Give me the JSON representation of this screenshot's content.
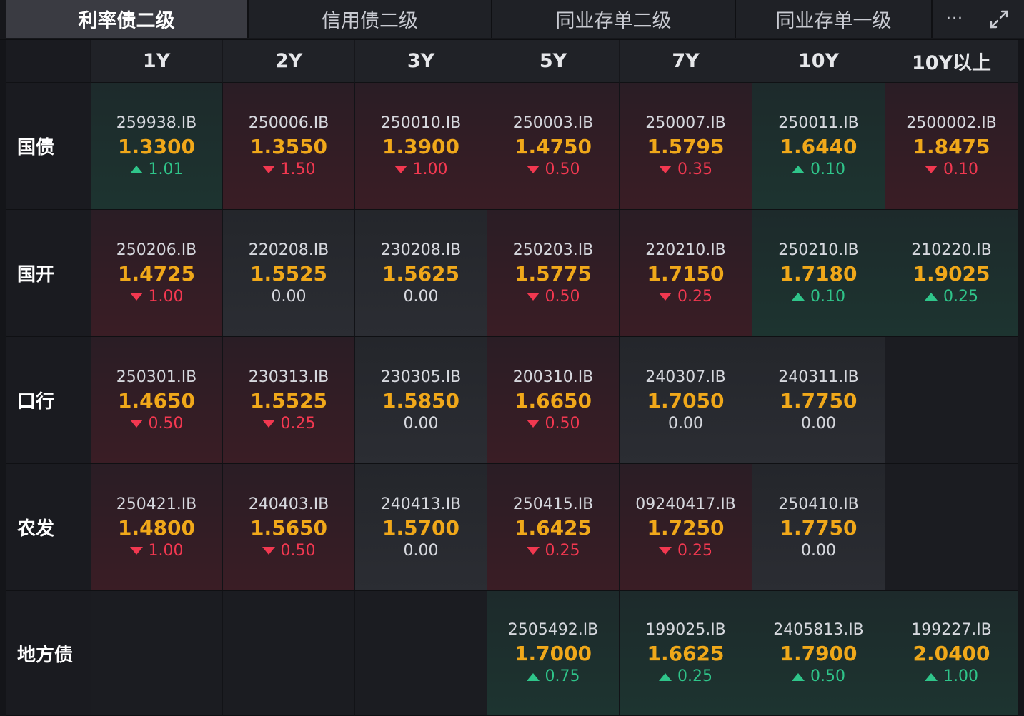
{
  "tabs": [
    {
      "label": "利率债二级",
      "active": true
    },
    {
      "label": "信用债二级",
      "active": false
    },
    {
      "label": "同业存单二级",
      "active": false
    },
    {
      "label": "同业存单一级",
      "active": false
    }
  ],
  "toolbar": {
    "more_label": "···"
  },
  "colors": {
    "up": "#2fc58a",
    "down": "#f23850",
    "yield": "#f0a81a"
  },
  "icons": {
    "more": "more-horizontal-icon",
    "expand": "expand-icon"
  },
  "columns": [
    "1Y",
    "2Y",
    "3Y",
    "5Y",
    "7Y",
    "10Y",
    "10Y以上"
  ],
  "rows": [
    {
      "label": "国债",
      "cells": [
        {
          "code": "259938.IB",
          "yield": "1.3300",
          "change": "1.01",
          "dir": "up"
        },
        {
          "code": "250006.IB",
          "yield": "1.3550",
          "change": "1.50",
          "dir": "down"
        },
        {
          "code": "250010.IB",
          "yield": "1.3900",
          "change": "1.00",
          "dir": "down"
        },
        {
          "code": "250003.IB",
          "yield": "1.4750",
          "change": "0.50",
          "dir": "down"
        },
        {
          "code": "250007.IB",
          "yield": "1.5795",
          "change": "0.35",
          "dir": "down"
        },
        {
          "code": "250011.IB",
          "yield": "1.6440",
          "change": "0.10",
          "dir": "up"
        },
        {
          "code": "2500002.IB",
          "yield": "1.8475",
          "change": "0.10",
          "dir": "down"
        }
      ]
    },
    {
      "label": "国开",
      "cells": [
        {
          "code": "250206.IB",
          "yield": "1.4725",
          "change": "1.00",
          "dir": "down"
        },
        {
          "code": "220208.IB",
          "yield": "1.5525",
          "change": "0.00",
          "dir": "flat"
        },
        {
          "code": "230208.IB",
          "yield": "1.5625",
          "change": "0.00",
          "dir": "flat"
        },
        {
          "code": "250203.IB",
          "yield": "1.5775",
          "change": "0.50",
          "dir": "down"
        },
        {
          "code": "220210.IB",
          "yield": "1.7150",
          "change": "0.25",
          "dir": "down"
        },
        {
          "code": "250210.IB",
          "yield": "1.7180",
          "change": "0.10",
          "dir": "up"
        },
        {
          "code": "210220.IB",
          "yield": "1.9025",
          "change": "0.25",
          "dir": "up"
        }
      ]
    },
    {
      "label": "口行",
      "cells": [
        {
          "code": "250301.IB",
          "yield": "1.4650",
          "change": "0.50",
          "dir": "down"
        },
        {
          "code": "230313.IB",
          "yield": "1.5525",
          "change": "0.25",
          "dir": "down"
        },
        {
          "code": "230305.IB",
          "yield": "1.5850",
          "change": "0.00",
          "dir": "flat"
        },
        {
          "code": "200310.IB",
          "yield": "1.6650",
          "change": "0.50",
          "dir": "down"
        },
        {
          "code": "240307.IB",
          "yield": "1.7050",
          "change": "0.00",
          "dir": "flat"
        },
        {
          "code": "240311.IB",
          "yield": "1.7750",
          "change": "0.00",
          "dir": "flat"
        },
        null
      ]
    },
    {
      "label": "农发",
      "cells": [
        {
          "code": "250421.IB",
          "yield": "1.4800",
          "change": "1.00",
          "dir": "down"
        },
        {
          "code": "240403.IB",
          "yield": "1.5650",
          "change": "0.50",
          "dir": "down"
        },
        {
          "code": "240413.IB",
          "yield": "1.5700",
          "change": "0.00",
          "dir": "flat"
        },
        {
          "code": "250415.IB",
          "yield": "1.6425",
          "change": "0.25",
          "dir": "down"
        },
        {
          "code": "09240417.IB",
          "yield": "1.7250",
          "change": "0.25",
          "dir": "down"
        },
        {
          "code": "250410.IB",
          "yield": "1.7750",
          "change": "0.00",
          "dir": "flat"
        },
        null
      ]
    },
    {
      "label": "地方债",
      "cells": [
        null,
        null,
        null,
        {
          "code": "2505492.IB",
          "yield": "1.7000",
          "change": "0.75",
          "dir": "up"
        },
        {
          "code": "199025.IB",
          "yield": "1.6625",
          "change": "0.25",
          "dir": "up"
        },
        {
          "code": "2405813.IB",
          "yield": "1.7900",
          "change": "0.50",
          "dir": "up"
        },
        {
          "code": "199227.IB",
          "yield": "2.0400",
          "change": "1.00",
          "dir": "up"
        }
      ]
    }
  ]
}
